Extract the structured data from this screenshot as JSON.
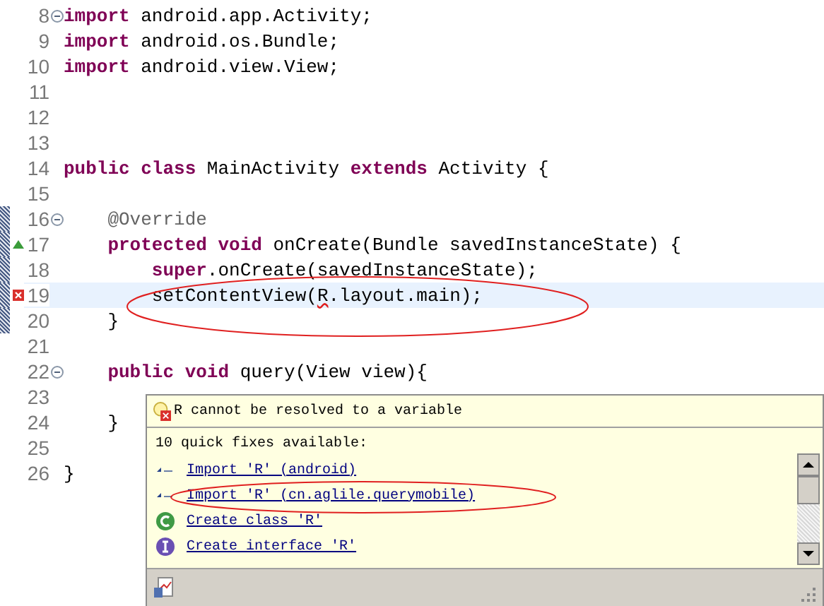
{
  "editor": {
    "lines": [
      {
        "number": "8",
        "kind": "plain",
        "fold": true,
        "changed": false,
        "selected": false,
        "tokens": [
          {
            "kind": "keyword",
            "text": "import"
          },
          {
            "kind": "plain",
            "text": " android.app.Activity;"
          }
        ]
      },
      {
        "number": "9",
        "kind": "plain",
        "fold": false,
        "changed": false,
        "selected": false,
        "tokens": [
          {
            "kind": "keyword",
            "text": "import"
          },
          {
            "kind": "plain",
            "text": " android.os.Bundle;"
          }
        ]
      },
      {
        "number": "10",
        "kind": "plain",
        "fold": false,
        "changed": false,
        "selected": false,
        "tokens": [
          {
            "kind": "keyword",
            "text": "import"
          },
          {
            "kind": "plain",
            "text": " android.view.View;"
          }
        ]
      },
      {
        "number": "11",
        "kind": "plain",
        "fold": false,
        "changed": false,
        "selected": false
      },
      {
        "number": "12",
        "kind": "plain",
        "fold": false,
        "changed": false,
        "selected": false
      },
      {
        "number": "13",
        "kind": "plain",
        "fold": false,
        "changed": false,
        "selected": false
      },
      {
        "number": "14",
        "kind": "plain",
        "fold": false,
        "changed": false,
        "selected": false,
        "tokens": [
          {
            "kind": "keyword",
            "text": "public class"
          },
          {
            "kind": "plain",
            "text": " MainActivity "
          },
          {
            "kind": "keyword",
            "text": "extends"
          },
          {
            "kind": "plain",
            "text": " Activity {"
          }
        ]
      },
      {
        "number": "15",
        "kind": "plain",
        "fold": false,
        "changed": false,
        "selected": false
      },
      {
        "number": "16",
        "kind": "plain",
        "fold": true,
        "changed": true,
        "selected": false,
        "tokens": [
          {
            "kind": "annotation",
            "text": "    @Override"
          }
        ]
      },
      {
        "number": "17",
        "kind": "override",
        "fold": false,
        "changed": true,
        "selected": false,
        "tokens": [
          {
            "kind": "keyword",
            "text": "    protected void"
          },
          {
            "kind": "plain",
            "text": " onCreate(Bundle savedInstanceState) {"
          }
        ]
      },
      {
        "number": "18",
        "kind": "plain",
        "fold": false,
        "changed": true,
        "selected": false,
        "tokens": [
          {
            "kind": "keyword",
            "text": "        super"
          },
          {
            "kind": "plain",
            "text": ".onCreate(savedInstanceState);"
          }
        ]
      },
      {
        "number": "19",
        "kind": "error",
        "fold": false,
        "changed": true,
        "selected": true,
        "tokens": [
          {
            "kind": "plain",
            "text": "        setContentView("
          },
          {
            "kind": "error",
            "text": "R"
          },
          {
            "kind": "plain",
            "text": ".layout.main);"
          }
        ]
      },
      {
        "number": "20",
        "kind": "plain",
        "fold": false,
        "changed": true,
        "selected": false,
        "tokens": [
          {
            "kind": "plain",
            "text": "    }"
          }
        ]
      },
      {
        "number": "21",
        "kind": "plain",
        "fold": false,
        "changed": false,
        "selected": false
      },
      {
        "number": "22",
        "kind": "plain",
        "fold": true,
        "changed": false,
        "selected": false,
        "tokens": [
          {
            "kind": "keyword",
            "text": "    public void"
          },
          {
            "kind": "plain",
            "text": " query(View view){"
          }
        ]
      },
      {
        "number": "23",
        "kind": "plain",
        "fold": false,
        "changed": false,
        "selected": false
      },
      {
        "number": "24",
        "kind": "plain",
        "fold": false,
        "changed": false,
        "selected": false,
        "tokens": [
          {
            "kind": "plain",
            "text": "    }"
          }
        ]
      },
      {
        "number": "25",
        "kind": "plain",
        "fold": false,
        "changed": false,
        "selected": false
      },
      {
        "number": "26",
        "kind": "plain",
        "fold": false,
        "changed": false,
        "selected": false,
        "tokens": [
          {
            "kind": "plain",
            "text": "}"
          }
        ]
      }
    ]
  },
  "quick_fix": {
    "problem": "R cannot be resolved to a variable",
    "summary": "10 quick fixes available:",
    "fixes": [
      {
        "kind": "import",
        "label": "Import 'R' (android)"
      },
      {
        "kind": "import",
        "label": "Import 'R' (cn.aglile.querymobile)"
      },
      {
        "kind": "class",
        "label": "Create class 'R'"
      },
      {
        "kind": "interface",
        "label": "Create interface 'R'"
      }
    ]
  }
}
